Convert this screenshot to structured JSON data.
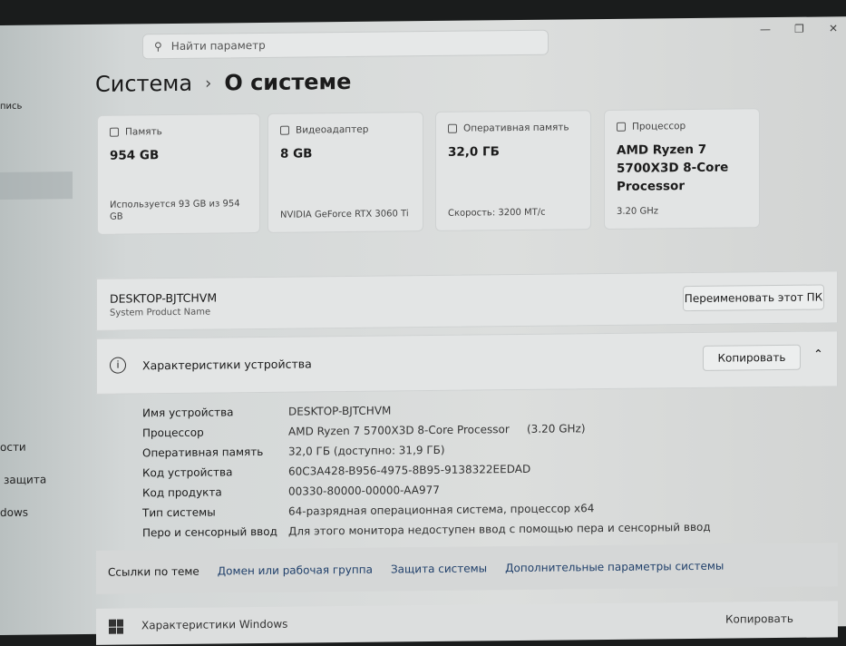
{
  "search": {
    "placeholder": "Найти параметр"
  },
  "breadcrumb": {
    "parent": "Система",
    "current": "О системе"
  },
  "sidebar": [
    "пись",
    "ости",
    "защита",
    "dows"
  ],
  "cards": [
    {
      "title": "Память",
      "value": "954 GB",
      "sub": "Используется 93 GB из 954 GB"
    },
    {
      "title": "Видеоадаптер",
      "value": "8 GB",
      "sub": "NVIDIA GeForce RTX 3060 Ti"
    },
    {
      "title": "Оперативная память",
      "value": "32,0 ГБ",
      "sub": "Скорость: 3200 МТ/с"
    },
    {
      "title": "Процессор",
      "value": "AMD Ryzen 7 5700X3D 8-Core Processor",
      "sub": "3.20 GHz"
    }
  ],
  "pc": {
    "name": "DESKTOP-BJTCHVM",
    "model": "System Product Name",
    "rename": "Переименовать этот ПК"
  },
  "device": {
    "title": "Характеристики устройства",
    "copy": "Копировать",
    "specs": [
      {
        "k": "Имя устройства",
        "v": "DESKTOP-BJTCHVM"
      },
      {
        "k": "Процессор",
        "v": "AMD Ryzen 7 5700X3D 8-Core Processor",
        "extra": "(3.20 GHz)"
      },
      {
        "k": "Оперативная память",
        "v": "32,0 ГБ (доступно: 31,9 ГБ)"
      },
      {
        "k": "Код устройства",
        "v": "60C3A428-B956-4975-8B95-9138322EEDAD"
      },
      {
        "k": "Код продукта",
        "v": "00330-80000-00000-AA977"
      },
      {
        "k": "Тип системы",
        "v": "64-разрядная операционная система, процессор x64"
      },
      {
        "k": "Перо и сенсорный ввод",
        "v": "Для этого монитора недоступен ввод с помощью пера и сенсорный ввод"
      }
    ]
  },
  "links": {
    "label": "Ссылки по теме",
    "items": [
      "Домен или рабочая группа",
      "Защита системы",
      "Дополнительные параметры системы"
    ]
  },
  "windows": {
    "title": "Характеристики Windows",
    "copy": "Копировать"
  }
}
